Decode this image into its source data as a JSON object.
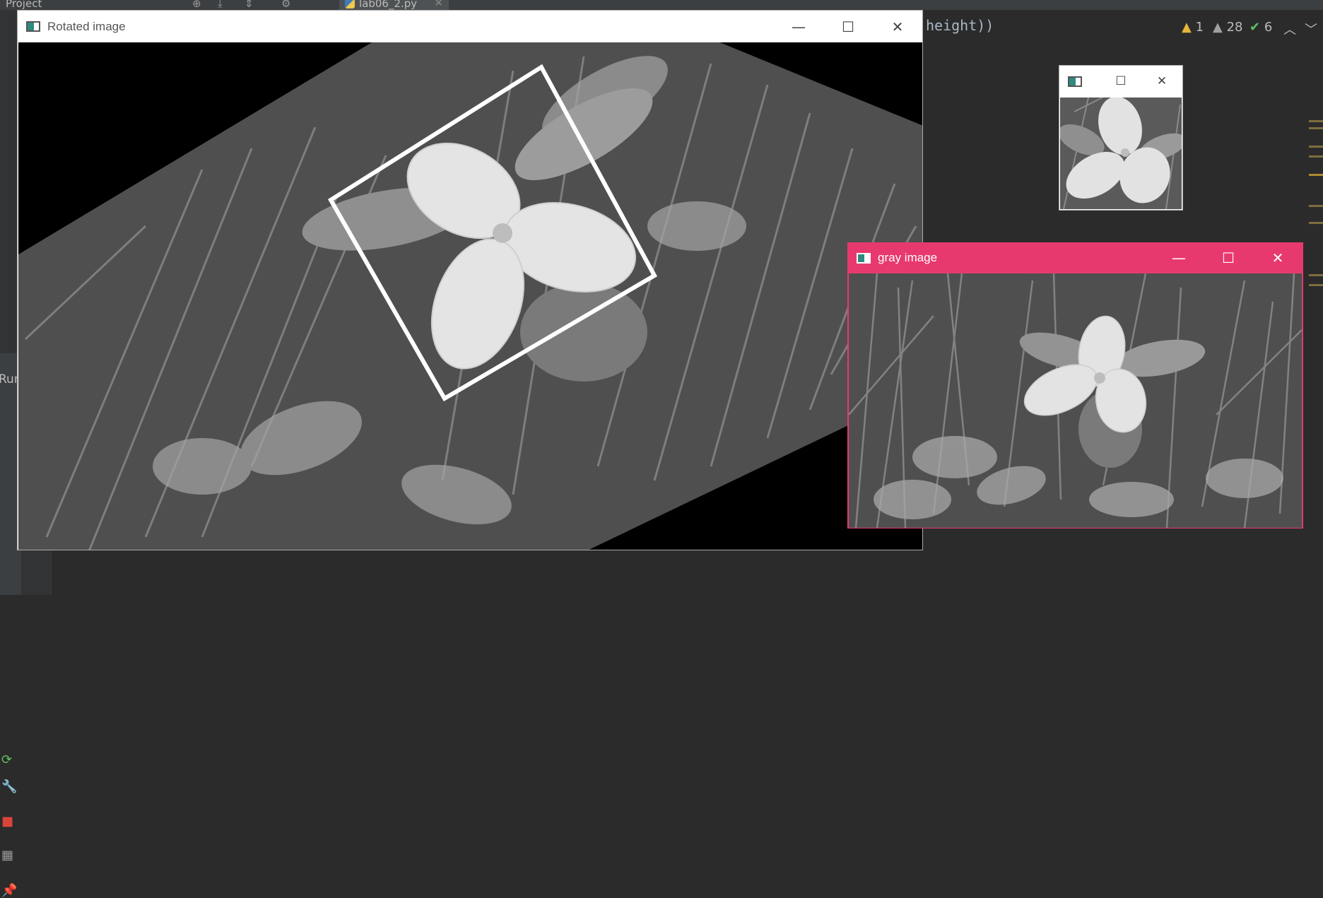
{
  "ide": {
    "project_label": "Project",
    "file_tab": "lab06_2.py",
    "code_fragment": "height))",
    "inspections": {
      "warnings": "1",
      "weak_warnings": "28",
      "typos": "6"
    },
    "run_label": "Run"
  },
  "windows": {
    "rotated": {
      "title": "Rotated image"
    },
    "small": {
      "title": ""
    },
    "gray": {
      "title": "gray image",
      "title_color": "#e8396f"
    }
  },
  "icons": {
    "minimize": "—",
    "maximize": "☐",
    "close": "✕"
  }
}
